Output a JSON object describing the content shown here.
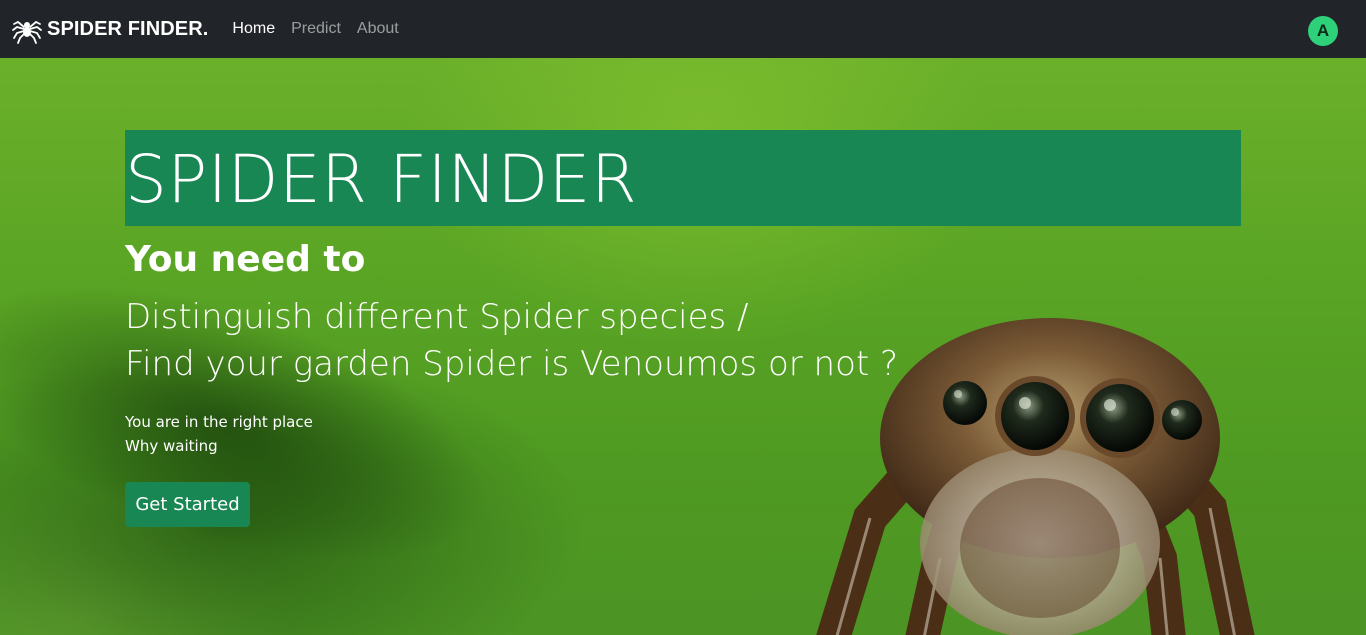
{
  "nav": {
    "brand": "SPIDER FINDER.",
    "brand_icon": "spider-icon",
    "links": [
      {
        "label": "Home",
        "active": true
      },
      {
        "label": "Predict",
        "active": false
      },
      {
        "label": "About",
        "active": false
      }
    ],
    "avatar_initial": "A",
    "avatar_color": "#2fd07a"
  },
  "hero": {
    "title": "SPIDER FINDER",
    "subtitle": "You need to",
    "lead_line_1": "Distinguish different Spider species /",
    "lead_line_2": "Find your garden Spider is Venoumos or not ?",
    "text_line_1": "You are in the right place",
    "text_line_2": "Why waiting",
    "cta_label": "Get Started",
    "accent_color": "#198754"
  }
}
